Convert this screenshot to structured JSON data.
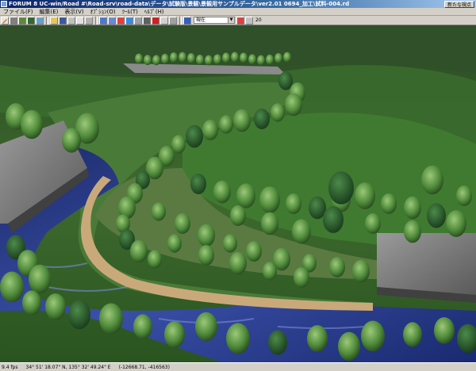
{
  "window": {
    "title": "FORUM 8    UC-win/Road    #\\Road-srv\\road-data\\データ\\試験版\\景観\\景観用サンプルデータ\\ver2.01 0694_加工\\試料-004.rd",
    "right_button": "新たな視点"
  },
  "menu": [
    "ファイル(F)",
    "編集(E)",
    "表示(V)",
    "ｵﾌﾟｼｮﾝ(O)",
    "ﾂｰﾙ(T)",
    "ﾍﾙﾌﾟ(H)"
  ],
  "toolbar": {
    "view_select_value": "現在",
    "speed_value": "20"
  },
  "status": {
    "fps": "9.4 fps",
    "latitude": "34° 51' 18.07\" N, 135° 32' 49.24\" E",
    "coords": "(-12668.71, -416563)"
  },
  "icons": [
    "pencil-icon",
    "road-icon",
    "terrain-icon",
    "tree-icon",
    "image-icon",
    "open-icon",
    "save-icon",
    "print-icon",
    "copy-icon",
    "cut-icon",
    "rotate-icon",
    "move-icon",
    "zoom-icon",
    "flag-icon",
    "route-icon",
    "camera-icon",
    "record-icon",
    "stop-icon",
    "settings-icon",
    "car-icon",
    "flag-red-icon"
  ],
  "colors": {
    "titlebar_start": "#0a246a",
    "titlebar_end": "#a6caf0",
    "ui_face": "#d4d0c8"
  }
}
